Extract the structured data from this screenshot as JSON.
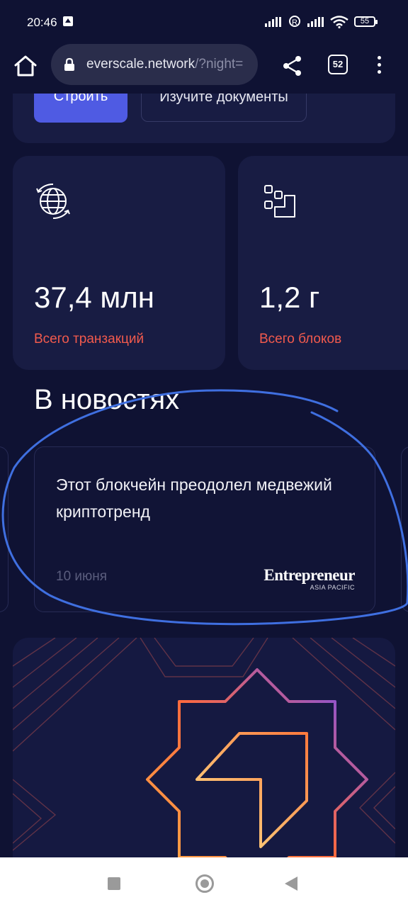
{
  "status_bar": {
    "time": "20:46",
    "registered_mark": "R",
    "battery": "55"
  },
  "browser": {
    "url_main": "everscale.network",
    "url_rest": "/?night=",
    "tab_count": "52"
  },
  "page": {
    "buttons": {
      "build": "Строить",
      "docs": "Изучите документы"
    },
    "stats": [
      {
        "value": "37,4 млн",
        "label": "Всего транзакций"
      },
      {
        "value": "1,2 г",
        "label": "Всего блоков"
      }
    ],
    "news": {
      "title": "В новостях",
      "headline": "Этот блокчейн преодолел медвежий криптотренд",
      "date": "10 июня",
      "source_name": "Entrepreneur",
      "source_sub": "ASIA PACIFIC"
    }
  },
  "colors": {
    "background": "#0f1233",
    "card": "#181c43",
    "accent_button": "#4f5be3",
    "stat_label": "#f25a4d",
    "annotation_stroke": "#3f6fe0"
  },
  "icons": [
    "home-icon",
    "lock-icon",
    "share-icon",
    "more-vert-icon",
    "globe-sync-icon",
    "blocks-icon"
  ]
}
